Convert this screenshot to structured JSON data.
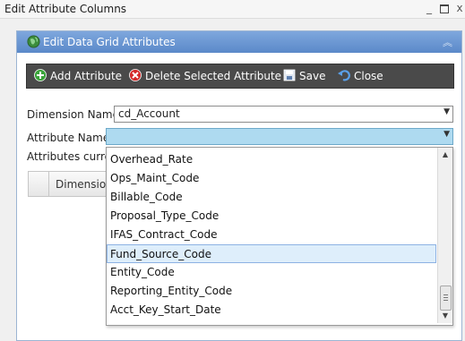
{
  "window": {
    "title": "Edit Attribute Columns"
  },
  "panel": {
    "title": "Edit Data Grid Attributes"
  },
  "toolbar": {
    "add_label": "Add Attribute",
    "delete_label": "Delete Selected Attribute",
    "save_label": "Save",
    "close_label": "Close"
  },
  "form": {
    "dimension_label": "Dimension Name",
    "dimension_value": "cd_Account",
    "attribute_label": "Attribute Name",
    "attribute_value": "",
    "current_label": "Attributes currer"
  },
  "grid": {
    "column_header": "Dimension"
  },
  "dropdown": {
    "items": [
      "Overhead_Rate",
      "Ops_Maint_Code",
      "Billable_Code",
      "Proposal_Type_Code",
      "IFAS_Contract_Code",
      "Fund_Source_Code",
      "Entity_Code",
      "Reporting_Entity_Code",
      "Acct_Key_Start_Date"
    ],
    "highlighted_index": 5
  },
  "colors": {
    "header": "#6a96d4",
    "toolbar": "#4a4a4a",
    "highlight": "#deeefb"
  }
}
